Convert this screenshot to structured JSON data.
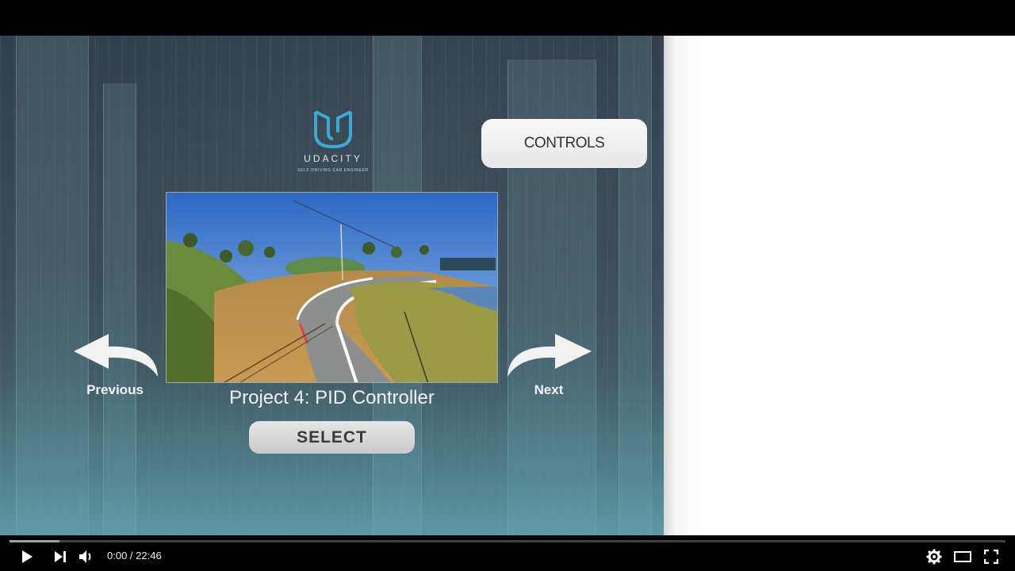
{
  "logo": {
    "name": "UDACITY",
    "subtitle": "SELF-DRIVING CAR ENGINEER"
  },
  "menu": {
    "controls_label": "CONTROLS",
    "previous_label": "Previous",
    "next_label": "Next",
    "project_title": "Project 4: PID Controller",
    "select_label": "SELECT"
  },
  "player": {
    "current_time": "0:00",
    "separator": " / ",
    "duration": "22:46",
    "loaded_fraction": 0.05,
    "icons": {
      "play": "play-icon",
      "next": "skip-next-icon",
      "volume": "volume-icon",
      "settings": "gear-icon",
      "theater": "theater-mode-icon",
      "fullscreen": "fullscreen-icon"
    }
  },
  "colors": {
    "logo_accent": "#3fa9d6",
    "panel_bg": "#33404b",
    "button_bg": "#f2f2f2"
  }
}
